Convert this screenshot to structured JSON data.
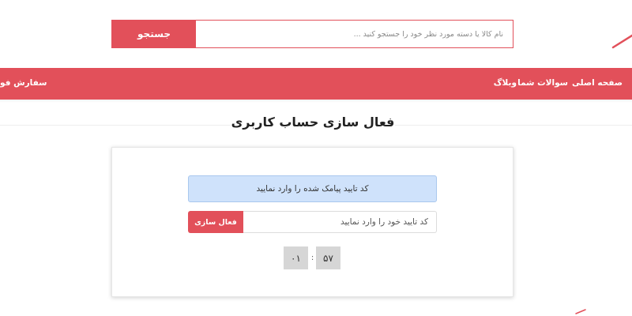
{
  "search": {
    "button_label": "جستجو",
    "placeholder": "نام کالا یا دسته مورد نظر خود را جستجو کنید ..."
  },
  "nav": {
    "items": [
      {
        "label": "صفحه اصلی"
      },
      {
        "label": "سوالات شما"
      },
      {
        "label": "وبلاگ"
      },
      {
        "label": "سفارش فو"
      }
    ]
  },
  "page": {
    "title": "فعال سازی حساب کاربری"
  },
  "activation": {
    "alert_text": "کد تایید پیامک شده را وارد نمایید",
    "code_placeholder": "کد تایید خود را وارد نمایید",
    "button_label": "فعال سازی"
  },
  "timer": {
    "minutes": "۵۷",
    "separator": ":",
    "seconds": "۰۱"
  },
  "colors": {
    "accent": "#e2505a",
    "alert_bg": "#cfe2fb",
    "timer_bg": "#d6d6d6"
  }
}
